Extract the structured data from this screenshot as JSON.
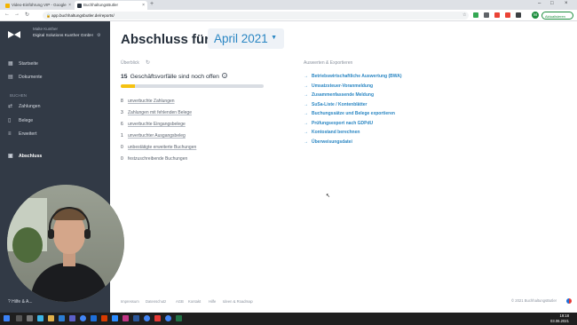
{
  "browser": {
    "tabs": [
      {
        "label": "Video-Einführung VIP - Google",
        "active": false
      },
      {
        "label": "BuchhaltungsButler",
        "active": true
      }
    ],
    "url": "app.buchhaltungsbutler.de/reports/",
    "update_label": "Aktualisieren"
  },
  "sidebar": {
    "user": "Malte Kunther",
    "company": "Digital Solutions Kunther GmbH",
    "items": [
      {
        "label": "Startseite",
        "icon": "dashboard-icon"
      },
      {
        "label": "Dokumente",
        "icon": "document-icon"
      },
      {
        "label": "Zahlungen",
        "icon": "transfer-icon"
      },
      {
        "label": "Belege",
        "icon": "receipt-icon"
      },
      {
        "label": "Erweitert",
        "icon": "layers-icon"
      },
      {
        "label": "Abschluss",
        "icon": "archive-icon",
        "active": true
      }
    ],
    "section_label": "BUCHEN",
    "help_label": "Hilfe & A..."
  },
  "main": {
    "heading": "Abschluss für",
    "month": "April 2021",
    "overview_title": "Überblick",
    "open_count": "15",
    "open_text": "Geschäftsvorfälle sind noch offen",
    "progress": 0.1,
    "tasks": [
      {
        "count": "8",
        "label": "unverbuchte Zahlungen",
        "link": true
      },
      {
        "count": "3",
        "label": "Zahlungen mit fehlenden Belege",
        "link": true
      },
      {
        "count": "6",
        "label": "unverbuchte Eingangsbelege",
        "link": true
      },
      {
        "count": "1",
        "label": "unverbuchter Ausgangsbeleg",
        "link": true
      },
      {
        "count": "0",
        "label": "unbestätigte erweiterte Buchungen",
        "link": true
      },
      {
        "count": "0",
        "label": "festzuschreibende Buchungen",
        "link": false
      }
    ],
    "exports_title": "Auswerten & Exportieren",
    "exports": [
      "Betriebswirtschaftliche Auswertung (BWA)",
      "Umsatzsteuer-Voranmeldung",
      "Zusammenfassende Meldung",
      "SuSa-Liste / Kontenblätter",
      "Buchungssätze und Belege exportieren",
      "Prüfungsexport nach GDPdU",
      "Kontostand berechnen",
      "Überweisungsdatei"
    ]
  },
  "footer": {
    "links": [
      "Impressum",
      "Datenschutz",
      "AGB",
      "Kontakt",
      "Hilfe",
      "Ideen & Roadmap"
    ],
    "copyright": "© 2021 BuchhaltungsButler"
  },
  "taskbar": {
    "time": "19:18",
    "date": "03.06.2021"
  },
  "colors": {
    "sidebar": "#323a46",
    "accent": "#2a86c3",
    "progress_fill": "#f5c211"
  }
}
